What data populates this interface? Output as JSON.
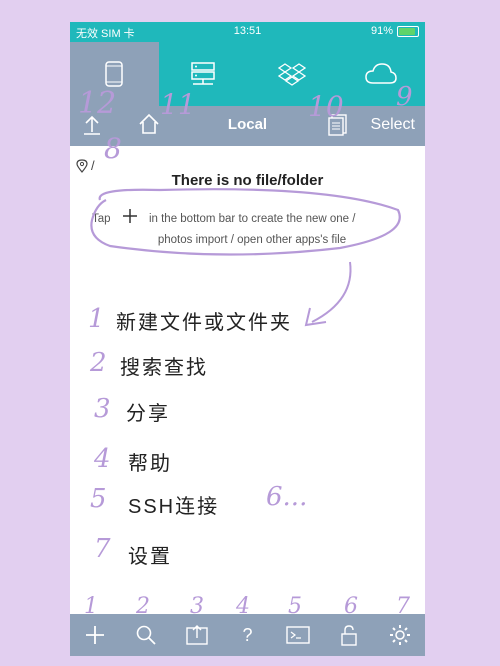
{
  "status": {
    "carrier": "无效 SIM 卡",
    "time": "13:51",
    "battery": "91%"
  },
  "tabs": [
    {
      "id": "phone",
      "icon": "phone-icon"
    },
    {
      "id": "server",
      "icon": "server-icon"
    },
    {
      "id": "dropbox",
      "icon": "dropbox-icon"
    },
    {
      "id": "cloud",
      "icon": "cloud-icon"
    }
  ],
  "navbar": {
    "title": "Local",
    "select_label": "Select"
  },
  "path": {
    "text": "/"
  },
  "empty": {
    "title": "There is no file/folder",
    "hint_pre": "Tap",
    "hint_post": "in the bottom bar to create the new one /",
    "hint_line2": "photos import / open other apps's file"
  },
  "notes": [
    {
      "num": "1",
      "text": "新建文件或文件夹"
    },
    {
      "num": "2",
      "text": "搜索查找"
    },
    {
      "num": "3",
      "text": "分享"
    },
    {
      "num": "4",
      "text": "帮助"
    },
    {
      "num": "5",
      "text": "SSH连接"
    },
    {
      "num": "7",
      "text": "设置"
    }
  ],
  "annotations": {
    "extra": "6...",
    "path_num": "8",
    "nav_nums": [
      "12",
      "11",
      "10",
      "9"
    ],
    "toolbar_nums": [
      "1",
      "2",
      "3",
      "4",
      "5",
      "6",
      "7"
    ]
  },
  "toolbar": [
    {
      "id": "add",
      "icon": "plus-icon"
    },
    {
      "id": "search",
      "icon": "search-icon"
    },
    {
      "id": "share",
      "icon": "share-icon"
    },
    {
      "id": "help",
      "icon": "help-icon"
    },
    {
      "id": "terminal",
      "icon": "terminal-icon"
    },
    {
      "id": "lock",
      "icon": "lock-icon"
    },
    {
      "id": "settings",
      "icon": "gear-icon"
    }
  ],
  "colors": {
    "accent": "#1fb8bb",
    "bar": "#8ea1b8",
    "annotation": "#b69ad8"
  }
}
